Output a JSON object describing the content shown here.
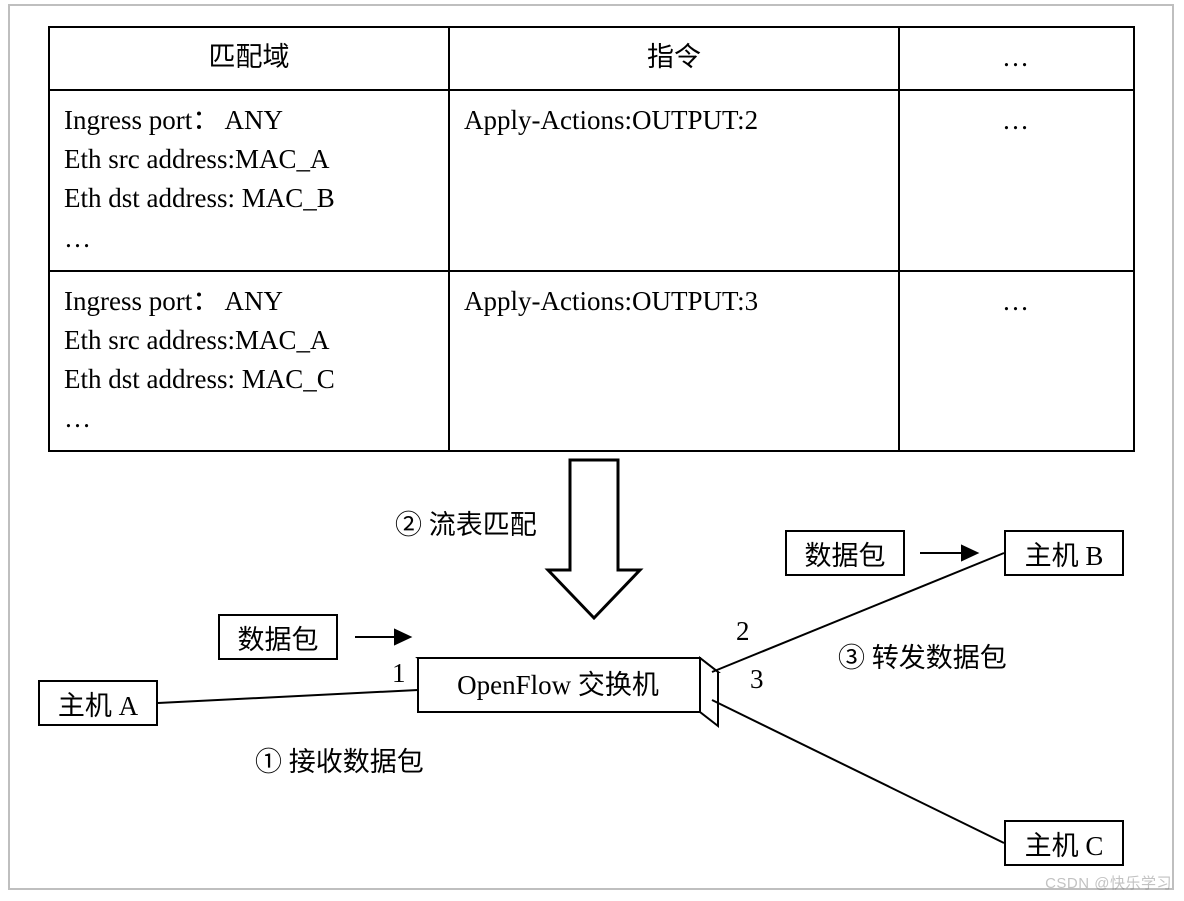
{
  "table": {
    "headers": {
      "match": "匹配域",
      "instr": "指令",
      "dots": "…"
    },
    "rows": [
      {
        "match_lines": [
          "Ingress port： ANY",
          "Eth src address:MAC_A",
          "Eth dst address: MAC_B",
          "…"
        ],
        "instr": "Apply-Actions:OUTPUT:2",
        "dots": "…"
      },
      {
        "match_lines": [
          "Ingress port： ANY",
          "Eth src address:MAC_A",
          "Eth dst address: MAC_C",
          "…"
        ],
        "instr": "Apply-Actions:OUTPUT:3",
        "dots": "…"
      }
    ]
  },
  "nodes": {
    "host_a": "主机 A",
    "host_b": "主机 B",
    "host_c": "主机 C",
    "packet1": "数据包",
    "packet2": "数据包",
    "switch": "OpenFlow 交换机"
  },
  "labels": {
    "port1": "1",
    "port2": "2",
    "port3": "3",
    "step2": "② 流表匹配",
    "step1": "① 接收数据包",
    "step3": "③ 转发数据包"
  },
  "watermark": "CSDN @快乐学习"
}
